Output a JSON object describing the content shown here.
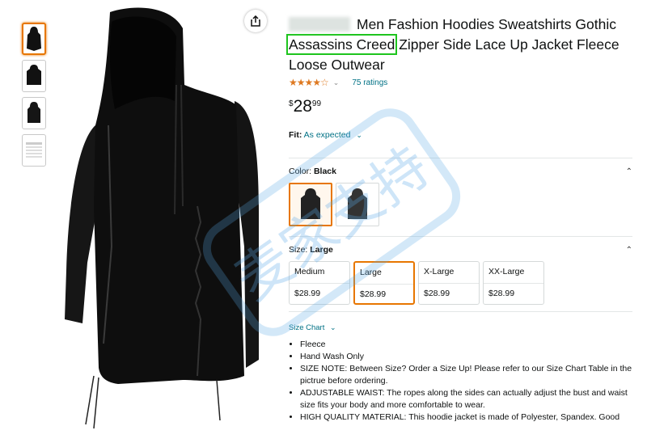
{
  "product": {
    "title_pre": "Men Fashion Hoodies Sweatshirts Gothic",
    "title_highlight": "Assassins Creed",
    "title_post": "Zipper Side Lace Up Jacket Fleece Loose Outwear",
    "rating_stars": "★★★★☆",
    "rating_value": 3.9,
    "ratings_count": "75 ratings",
    "price_symbol": "$",
    "price_whole": "28",
    "price_fraction": "99",
    "fit_label": "Fit:",
    "fit_value": "As expected",
    "color_label": "Color:",
    "color_value": "Black",
    "size_label": "Size:",
    "size_value": "Large",
    "sizes": [
      {
        "name": "Medium",
        "price": "$28.99"
      },
      {
        "name": "Large",
        "price": "$28.99"
      },
      {
        "name": "X-Large",
        "price": "$28.99"
      },
      {
        "name": "XX-Large",
        "price": "$28.99"
      }
    ],
    "size_chart": "Size Chart",
    "bullets": [
      "Fleece",
      "Hand Wash Only",
      "SIZE NOTE: Between Size? Order a Size Up! Please refer to our Size Chart Table in the pictrue before ordering.",
      "ADJUSTABLE WAIST: The ropes along the sides can actually adjust the bust and waist size fits your body and more comfortable to wear.",
      "HIGH QUALITY MATERIAL: This hoodie jacket is made of Polyester, Spandex. Good"
    ]
  },
  "watermark": {
    "text": "麦家支持"
  },
  "colors": {
    "accent_orange": "#e77600",
    "link_teal": "#007185",
    "star": "#de7921",
    "highlight_green": "#1ec41e"
  },
  "icons": {
    "share": "share-icon",
    "chevron": "chevron-down-icon",
    "collapse": "chevron-up-icon"
  }
}
